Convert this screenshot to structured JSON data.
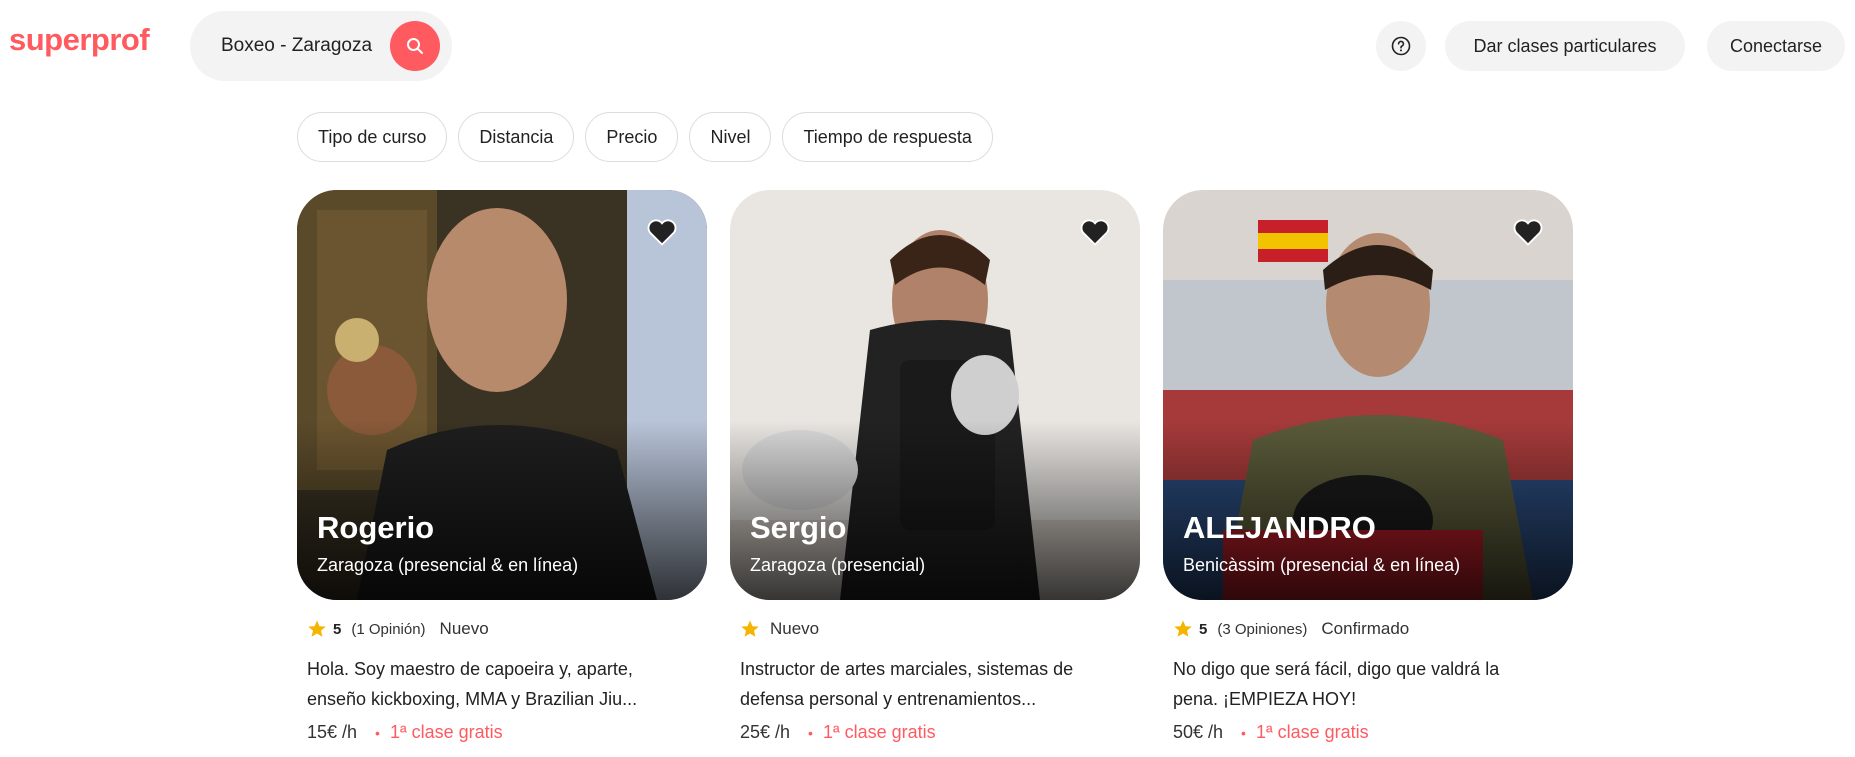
{
  "brand": {
    "logo": "superprof",
    "accent": "#ff5a5f"
  },
  "header": {
    "search_value": "Boxeo - Zaragoza",
    "teach_label": "Dar clases particulares",
    "login_label": "Conectarse"
  },
  "filters": [
    "Tipo de curso",
    "Distancia",
    "Precio",
    "Nivel",
    "Tiempo de respuesta"
  ],
  "cards": [
    {
      "name": "Rogerio",
      "location": "Zaragoza (presencial & en línea)",
      "rating": "5",
      "reviews": "(1 Opinión)",
      "status": "Nuevo",
      "description_line1": "Hola. Soy maestro de capoeira y, aparte,",
      "description_line2": "enseño kickboxing, MMA y Brazilian Jiu...",
      "price": "15€ /h",
      "free_label": "1ª clase gratis"
    },
    {
      "name": "Sergio",
      "location": "Zaragoza (presencial)",
      "rating": "",
      "reviews": "",
      "status": "Nuevo",
      "description_line1": "Instructor de artes marciales, sistemas de",
      "description_line2": "defensa personal y entrenamientos...",
      "price": "25€ /h",
      "free_label": "1ª clase gratis"
    },
    {
      "name": "ALEJANDRO",
      "location": "Benicàssim (presencial & en línea)",
      "rating": "5",
      "reviews": "(3 Opiniones)",
      "status": "Confirmado",
      "description_line1": "No digo que será fácil, digo que valdrá la",
      "description_line2": "pena. ¡EMPIEZA HOY!",
      "price": "50€ /h",
      "free_label": "1ª clase gratis"
    }
  ]
}
